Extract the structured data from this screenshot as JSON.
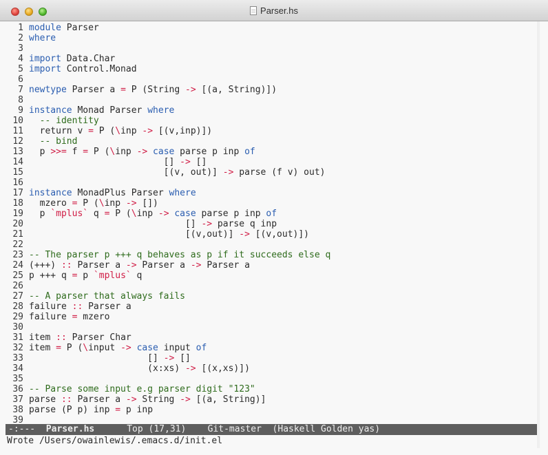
{
  "window": {
    "title": "Parser.hs"
  },
  "editor": {
    "lines": [
      {
        "n": "1",
        "segs": [
          [
            "k",
            "module"
          ],
          [
            "s",
            " Parser"
          ]
        ]
      },
      {
        "n": "2",
        "segs": [
          [
            "k",
            "where"
          ]
        ]
      },
      {
        "n": "3",
        "segs": []
      },
      {
        "n": "4",
        "segs": [
          [
            "k",
            "import"
          ],
          [
            "s",
            " Data.Char"
          ]
        ]
      },
      {
        "n": "5",
        "segs": [
          [
            "k",
            "import"
          ],
          [
            "s",
            " Control.Monad"
          ]
        ]
      },
      {
        "n": "6",
        "segs": []
      },
      {
        "n": "7",
        "segs": [
          [
            "k",
            "newtype"
          ],
          [
            "s",
            " Parser a "
          ],
          [
            "o",
            "="
          ],
          [
            "s",
            " P (String "
          ],
          [
            "o",
            "->"
          ],
          [
            "s",
            " [(a, String)])"
          ]
        ]
      },
      {
        "n": "8",
        "segs": []
      },
      {
        "n": "9",
        "segs": [
          [
            "k",
            "instance"
          ],
          [
            "s",
            " Monad Parser "
          ],
          [
            "k",
            "where"
          ]
        ]
      },
      {
        "n": "10",
        "segs": [
          [
            "c",
            "  -- identity"
          ]
        ]
      },
      {
        "n": "11",
        "segs": [
          [
            "s",
            "  return v "
          ],
          [
            "o",
            "="
          ],
          [
            "s",
            " P ("
          ],
          [
            "o",
            "\\"
          ],
          [
            "s",
            "inp "
          ],
          [
            "o",
            "->"
          ],
          [
            "s",
            " [(v,inp)])"
          ]
        ]
      },
      {
        "n": "12",
        "segs": [
          [
            "c",
            "  -- bind"
          ]
        ]
      },
      {
        "n": "13",
        "segs": [
          [
            "s",
            "  p "
          ],
          [
            "o",
            ">>="
          ],
          [
            "s",
            " f "
          ],
          [
            "o",
            "="
          ],
          [
            "s",
            " P ("
          ],
          [
            "o",
            "\\"
          ],
          [
            "s",
            "inp "
          ],
          [
            "o",
            "->"
          ],
          [
            "s",
            " "
          ],
          [
            "k",
            "case"
          ],
          [
            "s",
            " parse p inp "
          ],
          [
            "k",
            "of"
          ]
        ]
      },
      {
        "n": "14",
        "segs": [
          [
            "s",
            "                         [] "
          ],
          [
            "o",
            "->"
          ],
          [
            "s",
            " []"
          ]
        ]
      },
      {
        "n": "15",
        "segs": [
          [
            "s",
            "                         [(v, out)] "
          ],
          [
            "o",
            "->"
          ],
          [
            "s",
            " parse (f v) out)"
          ]
        ]
      },
      {
        "n": "16",
        "segs": []
      },
      {
        "n": "17",
        "segs": [
          [
            "k",
            "instance"
          ],
          [
            "s",
            " MonadPlus Parser "
          ],
          [
            "k",
            "where"
          ]
        ]
      },
      {
        "n": "18",
        "segs": [
          [
            "s",
            "  mzero "
          ],
          [
            "o",
            "="
          ],
          [
            "s",
            " P ("
          ],
          [
            "o",
            "\\"
          ],
          [
            "s",
            "inp "
          ],
          [
            "o",
            "->"
          ],
          [
            "s",
            " [])"
          ]
        ]
      },
      {
        "n": "19",
        "segs": [
          [
            "s",
            "  p "
          ],
          [
            "o",
            "`mplus`"
          ],
          [
            "s",
            " q "
          ],
          [
            "o",
            "="
          ],
          [
            "s",
            " P ("
          ],
          [
            "o",
            "\\"
          ],
          [
            "s",
            "inp "
          ],
          [
            "o",
            "->"
          ],
          [
            "s",
            " "
          ],
          [
            "k",
            "case"
          ],
          [
            "s",
            " parse p inp "
          ],
          [
            "k",
            "of"
          ]
        ]
      },
      {
        "n": "20",
        "segs": [
          [
            "s",
            "                             [] "
          ],
          [
            "o",
            "->"
          ],
          [
            "s",
            " parse q inp"
          ]
        ]
      },
      {
        "n": "21",
        "segs": [
          [
            "s",
            "                             [(v,out)] "
          ],
          [
            "o",
            "->"
          ],
          [
            "s",
            " [(v,out)])"
          ]
        ]
      },
      {
        "n": "22",
        "segs": []
      },
      {
        "n": "23",
        "segs": [
          [
            "c",
            "-- The parser p +++ q behaves as p if it succeeds else q"
          ]
        ]
      },
      {
        "n": "24",
        "segs": [
          [
            "s",
            "(+++) "
          ],
          [
            "o",
            "::"
          ],
          [
            "s",
            " Parser a "
          ],
          [
            "o",
            "->"
          ],
          [
            "s",
            " Parser a "
          ],
          [
            "o",
            "->"
          ],
          [
            "s",
            " Parser a"
          ]
        ]
      },
      {
        "n": "25",
        "segs": [
          [
            "s",
            "p +++ q "
          ],
          [
            "o",
            "="
          ],
          [
            "s",
            " p "
          ],
          [
            "o",
            "`mplus`"
          ],
          [
            "s",
            " q"
          ]
        ]
      },
      {
        "n": "26",
        "segs": []
      },
      {
        "n": "27",
        "segs": [
          [
            "c",
            "-- A parser that always fails"
          ]
        ]
      },
      {
        "n": "28",
        "segs": [
          [
            "s",
            "failure "
          ],
          [
            "o",
            "::"
          ],
          [
            "s",
            " Parser a"
          ]
        ]
      },
      {
        "n": "29",
        "segs": [
          [
            "s",
            "failure "
          ],
          [
            "o",
            "="
          ],
          [
            "s",
            " mzero"
          ]
        ]
      },
      {
        "n": "30",
        "segs": []
      },
      {
        "n": "31",
        "segs": [
          [
            "s",
            "item "
          ],
          [
            "o",
            "::"
          ],
          [
            "s",
            " Parser Char"
          ]
        ]
      },
      {
        "n": "32",
        "segs": [
          [
            "s",
            "item "
          ],
          [
            "o",
            "="
          ],
          [
            "s",
            " P ("
          ],
          [
            "o",
            "\\"
          ],
          [
            "s",
            "input "
          ],
          [
            "o",
            "->"
          ],
          [
            "s",
            " "
          ],
          [
            "k",
            "case"
          ],
          [
            "s",
            " input "
          ],
          [
            "k",
            "of"
          ]
        ]
      },
      {
        "n": "33",
        "segs": [
          [
            "s",
            "                      [] "
          ],
          [
            "o",
            "->"
          ],
          [
            "s",
            " []"
          ]
        ]
      },
      {
        "n": "34",
        "segs": [
          [
            "s",
            "                      (x:xs) "
          ],
          [
            "o",
            "->"
          ],
          [
            "s",
            " [(x,xs)])"
          ]
        ]
      },
      {
        "n": "35",
        "segs": []
      },
      {
        "n": "36",
        "segs": [
          [
            "c",
            "-- Parse some input e.g parser digit \"123\""
          ]
        ]
      },
      {
        "n": "37",
        "segs": [
          [
            "s",
            "parse "
          ],
          [
            "o",
            "::"
          ],
          [
            "s",
            " Parser a "
          ],
          [
            "o",
            "->"
          ],
          [
            "s",
            " String "
          ],
          [
            "o",
            "->"
          ],
          [
            "s",
            " [(a, String)]"
          ]
        ]
      },
      {
        "n": "38",
        "segs": [
          [
            "s",
            "parse (P p) inp "
          ],
          [
            "o",
            "="
          ],
          [
            "s",
            " p inp"
          ]
        ]
      },
      {
        "n": "39",
        "segs": []
      }
    ]
  },
  "modeline": {
    "status": "-:---  ",
    "buffer": "Parser.hs",
    "position": "      Top (17,31)    ",
    "branch": "Git-master  ",
    "modes": "(Haskell Golden yas)"
  },
  "echo_area": {
    "message": "Wrote /Users/owainlewis/.emacs.d/init.el"
  },
  "colors": {
    "keyword": "#2a5db0",
    "operator": "#d01c45",
    "comment": "#2e6b1c",
    "modeline_bg": "#5e5e5e"
  }
}
